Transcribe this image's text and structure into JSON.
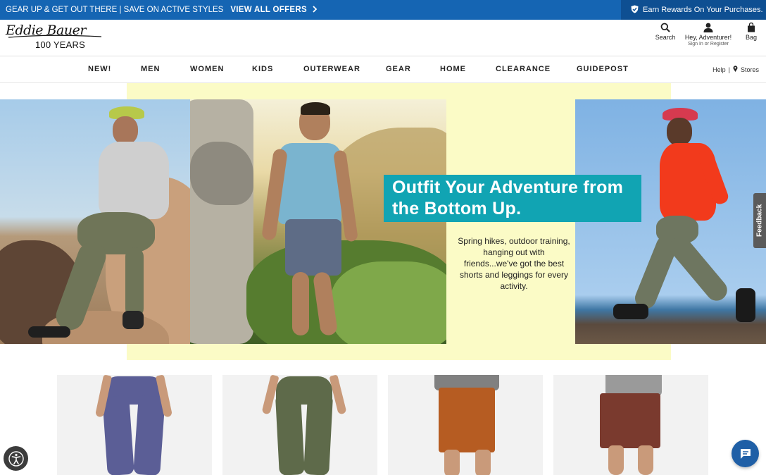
{
  "promo": {
    "message": "GEAR UP & GET OUT THERE | SAVE ON ACTIVE STYLES",
    "offers_link": "VIEW ALL OFFERS",
    "rewards": "Earn Rewards On Your Purchases."
  },
  "header": {
    "logo_script": "Eddie Bauer",
    "logo_years": "100 YEARS",
    "search_label": "Search",
    "account_label": "Hey, Adventurer!",
    "account_sub": "Sign In or Register",
    "bag_label": "Bag"
  },
  "nav": {
    "items": [
      "NEW!",
      "MEN",
      "WOMEN",
      "KIDS",
      "OUTERWEAR",
      "GEAR",
      "HOME",
      "CLEARANCE",
      "GUIDEPOST"
    ],
    "help": "Help",
    "separator": "|",
    "stores": "Stores"
  },
  "hero": {
    "title": "Outfit Your Adventure from the Bottom Up.",
    "copy": "Spring hikes, outdoor training, hanging out with friends...we've got the best shorts and leggings for every activity."
  },
  "feedback_tab": "Feedback",
  "colors": {
    "promo_bg": "#1565b3",
    "rewards_bg": "#0e4f92",
    "hero_panel": "#fbfbc6",
    "headline_bg": "#11a4b3",
    "chat_bg": "#1f5fa6"
  }
}
